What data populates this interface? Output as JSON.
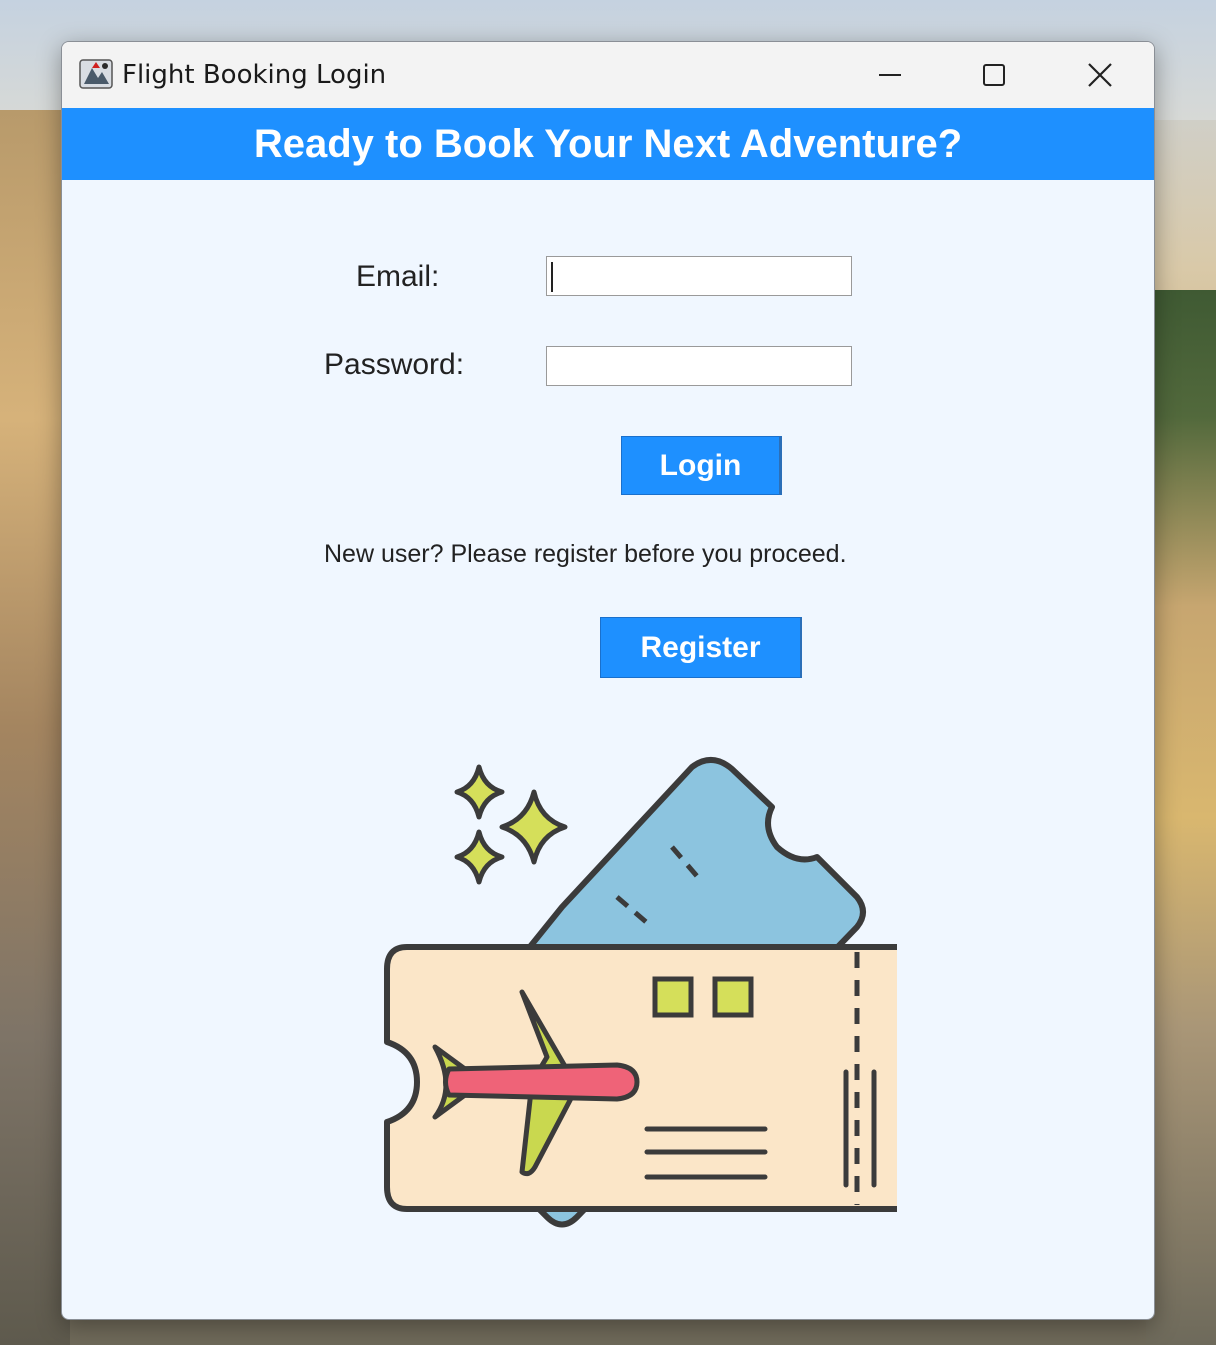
{
  "window": {
    "title": "Flight Booking Login",
    "icon": "java-app-icon",
    "controls": {
      "minimize": "minimize-icon",
      "maximize": "maximize-icon",
      "close": "close-icon"
    }
  },
  "banner": {
    "text": "Ready to Book Your Next Adventure?",
    "color": "#1e90ff"
  },
  "form": {
    "email_label": "Email:",
    "email_value": "",
    "password_label": "Password:",
    "password_value": "",
    "login_label": "Login",
    "notice": "New user? Please register before you proceed.",
    "register_label": "Register"
  },
  "illustration": {
    "icon": "flight-ticket-illustration"
  },
  "colors": {
    "accent": "#1e90ff",
    "panel_bg": "#f0f7ff"
  }
}
